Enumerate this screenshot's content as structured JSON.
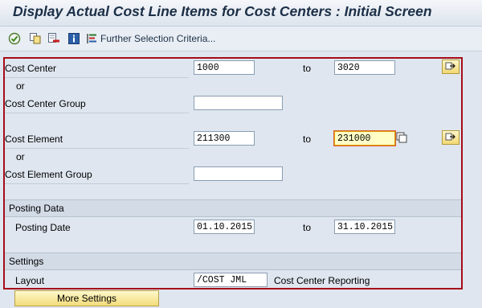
{
  "window": {
    "title": "Display Actual Cost Line Items for Cost Centers : Initial Screen"
  },
  "toolbar": {
    "icons": [
      "execute-icon",
      "copy-selection-icon",
      "delete-selection-icon",
      "info-icon",
      "selection-criteria-icon"
    ],
    "further_selection_label": "Further Selection Criteria..."
  },
  "form": {
    "cost_center": {
      "label": "Cost Center",
      "from": "1000",
      "to_label": "to",
      "to": "3020"
    },
    "or1": "or",
    "cost_center_group": {
      "label": "Cost Center Group",
      "value": ""
    },
    "cost_element": {
      "label": "Cost Element",
      "from": "211300",
      "to_label": "to",
      "to": "231000"
    },
    "or2": "or",
    "cost_element_group": {
      "label": "Cost Element Group",
      "value": ""
    },
    "posting_section": {
      "header": "Posting Data"
    },
    "posting_date": {
      "label": "Posting Date",
      "from": "01.10.2015",
      "to_label": "to",
      "to": "31.10.2015"
    },
    "settings_section": {
      "header": "Settings"
    },
    "layout": {
      "label": "Layout",
      "value": "/COST JML",
      "description": "Cost Center Reporting"
    }
  },
  "buttons": {
    "more_settings": "More Settings"
  },
  "colors": {
    "highlight_frame": "#a50d18",
    "active_field": "#ffffc6",
    "background": "#dfe6ef"
  }
}
